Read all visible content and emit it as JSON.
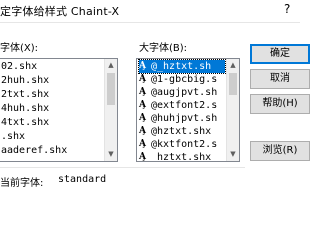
{
  "window": {
    "title": "定字体给样式 Chaint-X",
    "help_glyph": "?"
  },
  "small_font": {
    "label": "字体(X):",
    "items": [
      "02.shx",
      "2huh.shx",
      "2txt.shx",
      "4huh.shx",
      "4txt.shx",
      ".shx",
      "aaderef.shx"
    ]
  },
  "big_font": {
    "label": "大字体(B):",
    "selected_index": 0,
    "items": [
      {
        "icon": "font-icon",
        "text": "@_hztxt.sh"
      },
      {
        "icon": "font-icon",
        "text": "@1-gbcbig.s"
      },
      {
        "icon": "font-icon",
        "text": "@augjpvt.sh"
      },
      {
        "icon": "font-icon",
        "text": "@extfont2.s"
      },
      {
        "icon": "font-icon",
        "text": "@huhjpvt.sh"
      },
      {
        "icon": "font-icon",
        "text": "@hztxt.shx"
      },
      {
        "icon": "font-icon",
        "text": "@kxtfont2.s"
      },
      {
        "icon": "font-icon",
        "text": "_hztxt.shx"
      }
    ]
  },
  "buttons": {
    "ok": "确定",
    "cancel": "取消",
    "help": "帮助(H)",
    "browse": "浏览(R)"
  },
  "status": {
    "current_font_label": "当前字体:",
    "current_font_value": "standard"
  },
  "icons": {
    "font_icon_glyph": "A̧",
    "scroll_up_glyph": "▲",
    "scroll_down_glyph": "▼"
  },
  "colors": {
    "selection": "#0078d7",
    "default_button_border": "#0078d7"
  }
}
